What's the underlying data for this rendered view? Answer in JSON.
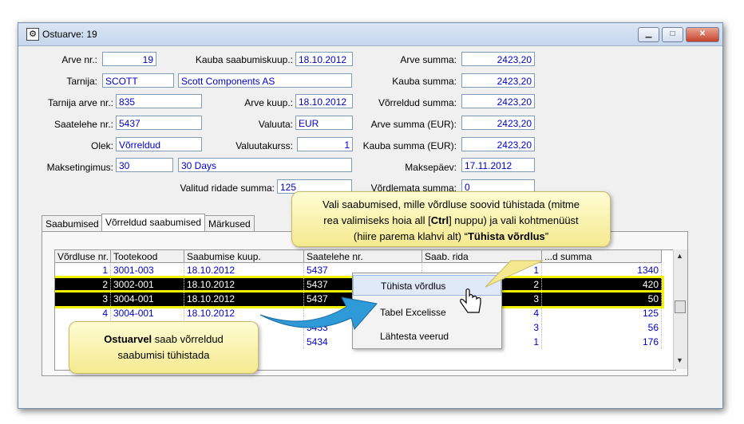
{
  "window": {
    "title": "Ostuarve: 19",
    "icon": "gear-icon"
  },
  "form": {
    "arve_nr_label": "Arve nr.:",
    "arve_nr": "19",
    "kauba_saab_label": "Kauba saabumiskuup.:",
    "kauba_saab": "18.10.2012",
    "arve_summa_label": "Arve summa:",
    "arve_summa": "2423,20",
    "tarnija_label": "Tarnija:",
    "tarnija_code": "SCOTT",
    "tarnija_name": "Scott Components AS",
    "kauba_summa_label": "Kauba summa:",
    "kauba_summa": "2423,20",
    "tarnija_arve_label": "Tarnija arve nr.:",
    "tarnija_arve": "835",
    "arve_kuup_label": "Arve kuup.:",
    "arve_kuup": "18.10.2012",
    "vorreldud_summa_label": "Võrreldud summa:",
    "vorreldud_summa": "2423,20",
    "saatelehe_label": "Saatelehe nr.:",
    "saatelehe": "5437",
    "valuuta_label": "Valuuta:",
    "valuuta": "EUR",
    "arve_summa_eur_label": "Arve summa (EUR):",
    "arve_summa_eur": "2423,20",
    "olek_label": "Olek:",
    "olek": "Võrreldud",
    "valuutakurss_label": "Valuutakurss:",
    "valuutakurss": "1",
    "kauba_summa_eur_label": "Kauba summa (EUR):",
    "kauba_summa_eur": "2423,20",
    "maksetingimus_label": "Maksetingimus:",
    "maksetingimus_code": "30",
    "maksetingimus_name": "30 Days",
    "maksepaev_label": "Maksepäev:",
    "maksepaev": "17.11.2012",
    "valitud_label": "Valitud ridade summa:",
    "valitud": "125",
    "vordlemata_label": "Võrdlemata summa:",
    "vordlemata": "0"
  },
  "tabs": [
    "Saabumised",
    "Võrreldud saabumised",
    "Märkused"
  ],
  "grid": {
    "headers": [
      "Võrdluse nr.",
      "Tootekood",
      "Saabumise kuup.",
      "Saatelehe nr.",
      "Saab. rida",
      "...d summa"
    ],
    "rows": [
      {
        "nr": "1",
        "kood": "3001-003",
        "kuup": "18.10.2012",
        "saateleht": "5437",
        "rida": "1",
        "summa": "1340",
        "selected": false
      },
      {
        "nr": "2",
        "kood": "3002-001",
        "kuup": "18.10.2012",
        "saateleht": "5437",
        "rida": "2",
        "summa": "420",
        "selected": true
      },
      {
        "nr": "3",
        "kood": "3004-001",
        "kuup": "18.10.2012",
        "saateleht": "5437",
        "rida": "3",
        "summa": "50",
        "selected": true
      },
      {
        "nr": "4",
        "kood": "3004-001",
        "kuup": "18.10.2012",
        "saateleht": "",
        "rida": "4",
        "summa": "125",
        "selected": false
      },
      {
        "nr": "",
        "kood": "",
        "kuup": "",
        "saateleht": "5433",
        "rida": "3",
        "summa": "56",
        "selected": false
      },
      {
        "nr": "",
        "kood": "",
        "kuup": "",
        "saateleht": "5434",
        "rida": "1",
        "summa": "176",
        "selected": false
      }
    ]
  },
  "context_menu": [
    "Tühista võrdlus",
    "Tabel Excelisse",
    "Lähtesta veerud"
  ],
  "callout_top": {
    "line1": "Vali saabumised, mille võrdluse soovid tühistada (mitme",
    "line2a": "rea valimiseks hoia all [",
    "line2b": "Ctrl",
    "line2c": "] nuppu) ja vali kohtmenüüst",
    "line3a": "(hiire parema klahvi alt) “",
    "line3b": "Tühista võrdlus",
    "line3c": "”"
  },
  "callout_bottom": {
    "bold": "Ostuarvel",
    "rest1": " saab võrreldud",
    "line2": "saabumisi  tühistada"
  }
}
